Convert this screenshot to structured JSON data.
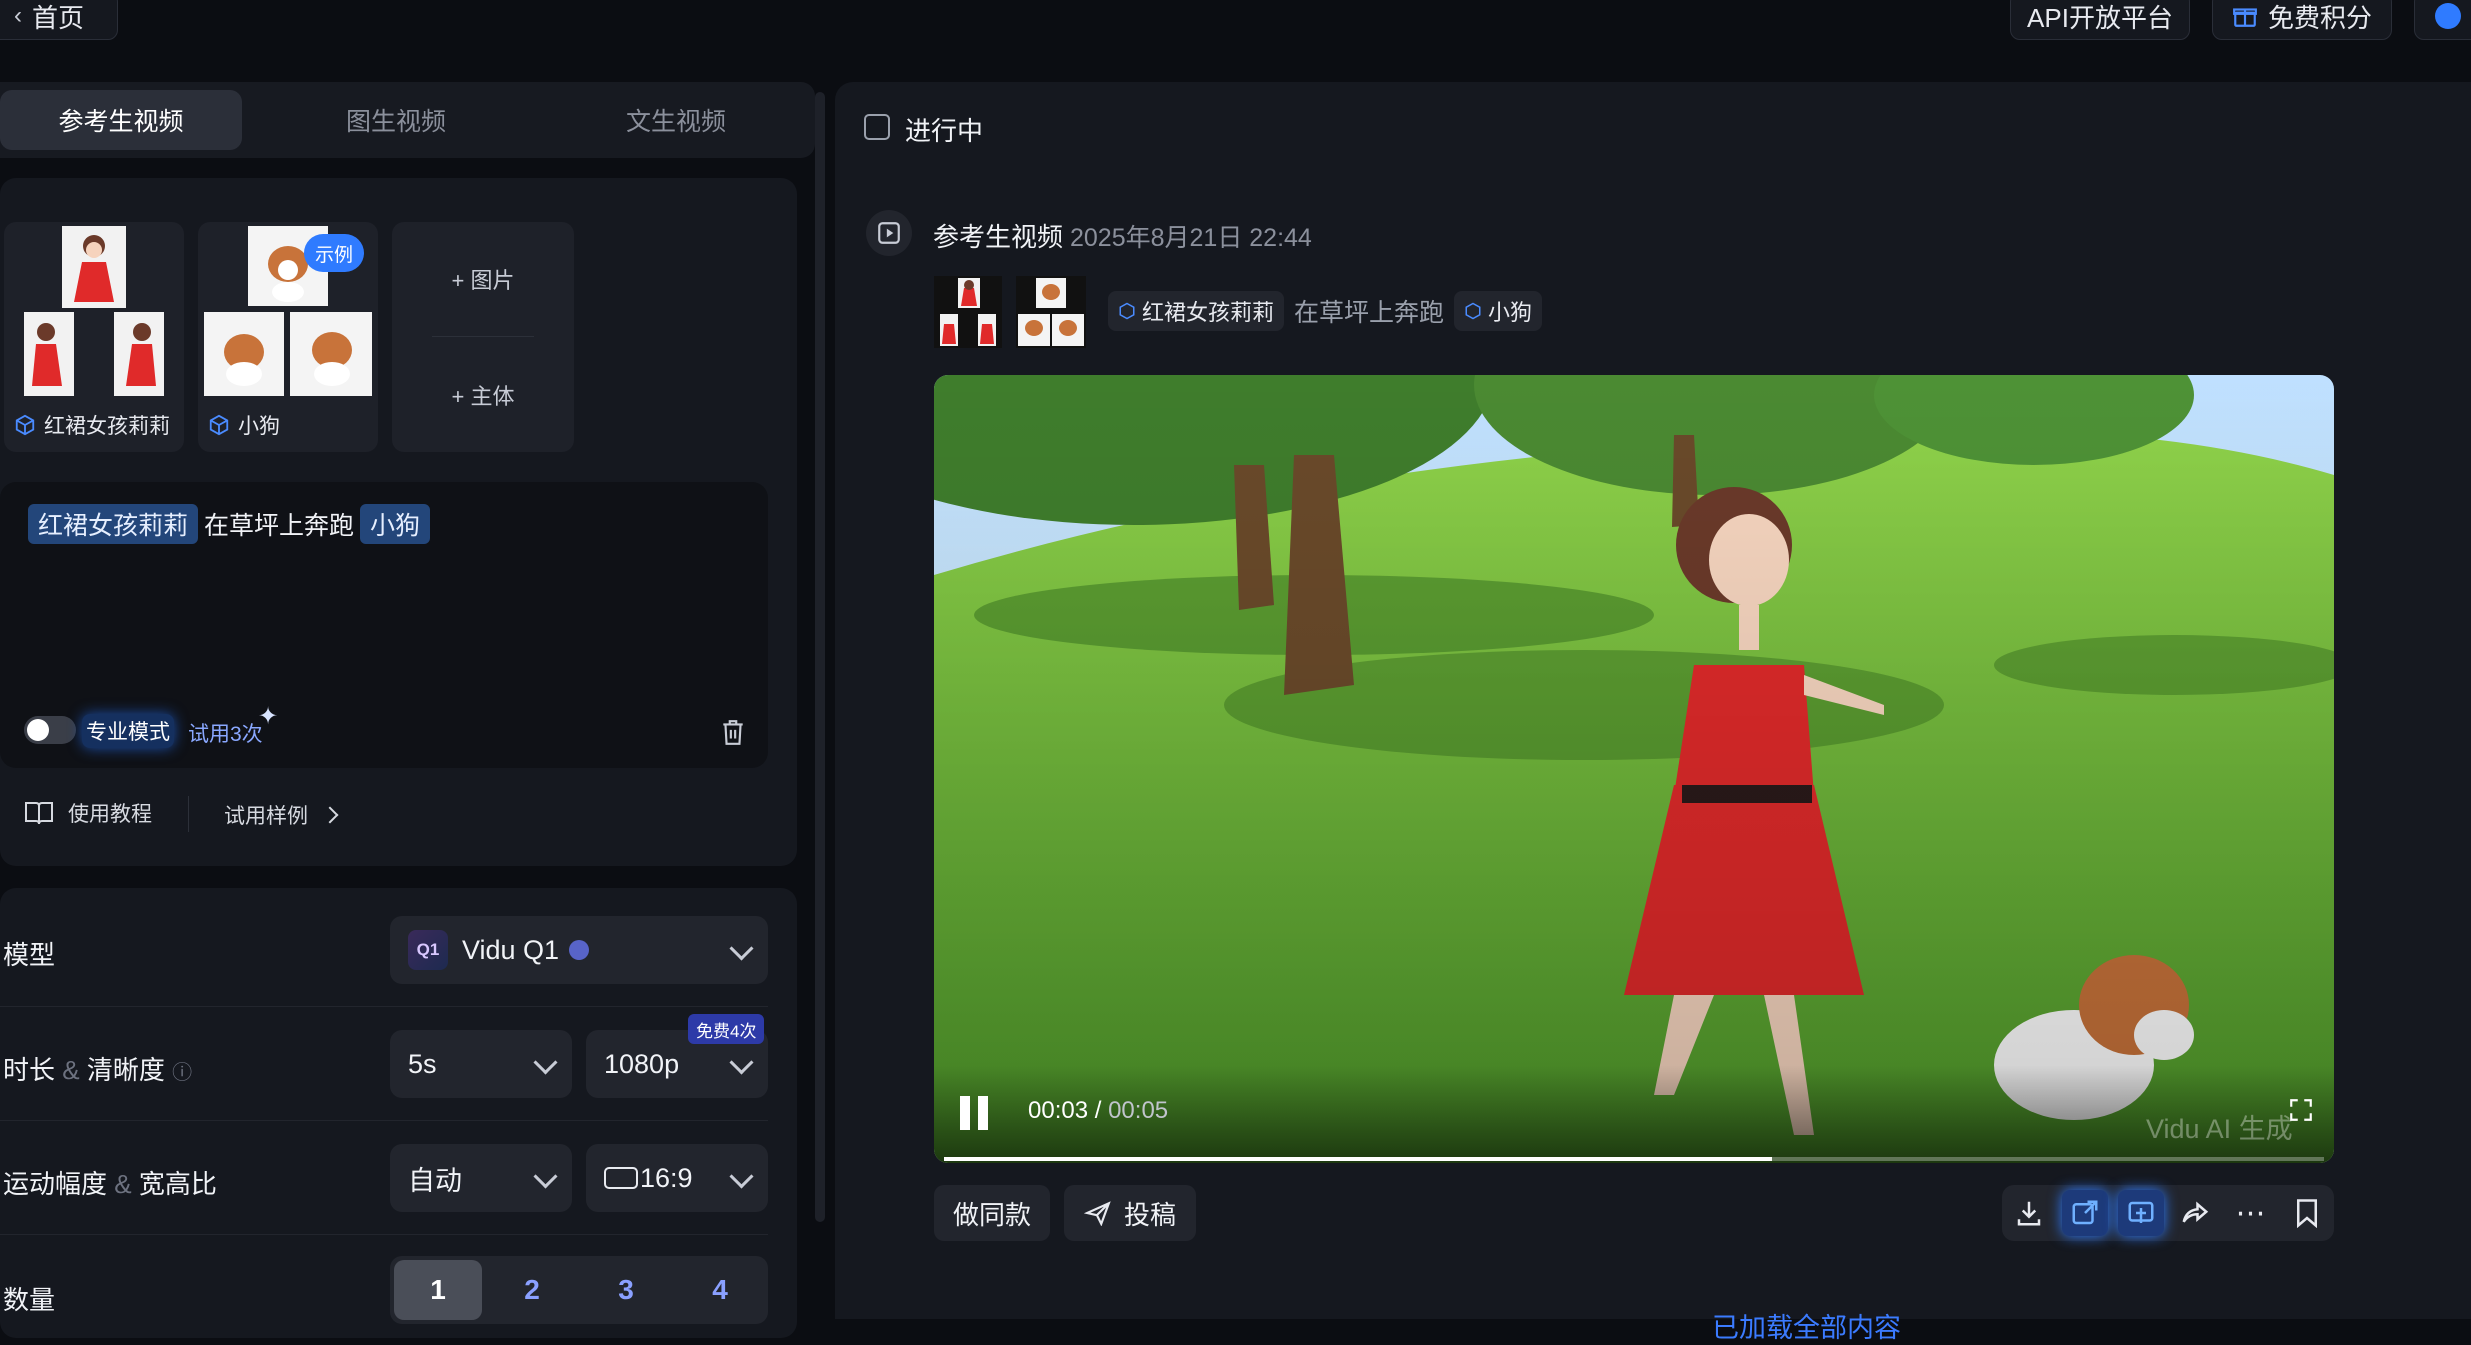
{
  "topbar": {
    "back_label": "首页",
    "api_label": "API开放平台",
    "free_points_label": "免费积分"
  },
  "tabs": [
    {
      "label": "参考生视频",
      "active": true
    },
    {
      "label": "图生视频",
      "active": false
    },
    {
      "label": "文生视频",
      "active": false
    }
  ],
  "references": {
    "subject1_label": "红裙女孩莉莉",
    "subject2_label": "小狗",
    "example_badge": "示例",
    "add_image_label": "+ 图片",
    "add_subject_label": "+ 主体"
  },
  "prompt": {
    "tag1": "红裙女孩莉莉",
    "middle_text": "在草坪上奔跑",
    "tag2": "小狗",
    "pro_mode_label": "专业模式",
    "trial_label": "试用3次"
  },
  "help": {
    "tutorial_label": "使用教程",
    "samples_label": "试用样例"
  },
  "settings": {
    "model_label": "模型",
    "model_value": "Vidu Q1",
    "model_icon_text": "Q1",
    "duration_label": "时长",
    "amp": "&",
    "clarity_label": "清晰度",
    "duration_value": "5s",
    "clarity_value": "1080p",
    "free_badge": "免费4次",
    "motion_label": "运动幅度",
    "ratio_label": "宽高比",
    "motion_value": "自动",
    "ratio_value": "16:9",
    "quantity_label": "数量",
    "quantity_options": [
      "1",
      "2",
      "3",
      "4"
    ],
    "quantity_selected": "1"
  },
  "task": {
    "in_progress_label": "进行中",
    "type_label": "参考生视频",
    "datetime": "2025年8月21日 22:44",
    "tag1": "红裙女孩莉莉",
    "middle_text": "在草坪上奔跑",
    "tag2": "小狗"
  },
  "player": {
    "current_time": "00:03",
    "separator": " / ",
    "total_time": "00:05",
    "watermark": "Vidu AI 生成",
    "progress": 0.6
  },
  "actions": {
    "make_same_label": "做同款",
    "submit_label": "投稿",
    "load_all_label": "已加载全部内容"
  },
  "colors": {
    "accent": "#3b7bff",
    "tag_bg": "#23467a",
    "panel_bg": "#15181f"
  }
}
